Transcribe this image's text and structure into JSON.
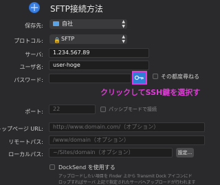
{
  "title": "SFTP接続方法",
  "form": {
    "save_to_label": "保存先:",
    "save_to_value": "自社",
    "protocol_label": "プロトコル:",
    "protocol_value": "SFTP",
    "server_label": "サーバ:",
    "server_value": "1.234.567.89",
    "username_label": "ユーザ名:",
    "username_value": "user-hoge",
    "password_label": "パスワード:",
    "password_value": "",
    "ask_each_time_label": "その都度尋ねる",
    "port_label": "ポート:",
    "port_placeholder": "22",
    "passive_label": "パッシブモードで接続",
    "top_page_url_label": "トップページ URL:",
    "top_page_url_placeholder": "http://www.domain.com/（オプション）",
    "remote_path_label": "リモートパス:",
    "remote_path_placeholder": "/www/domain（オプション）",
    "local_path_label": "ローカルパス:",
    "local_path_placeholder": "~/Sites/domain（オプション）",
    "settings_button": "設定...",
    "docksend_label": "DockSend を使用する",
    "footer_text_1": "アップロードしたい項目を Finder 上から Transmit Dock アイコンにド",
    "footer_text_2": "ロップすればサーバ 上記で指定されたサーバへアップロードが行われます"
  },
  "annotation": {
    "text": "クリックしてSSH鍵を選択す",
    "color": "#e03ad8"
  },
  "colors": {
    "background": "#2a2a2c",
    "key_button": "#2f7ed8"
  }
}
